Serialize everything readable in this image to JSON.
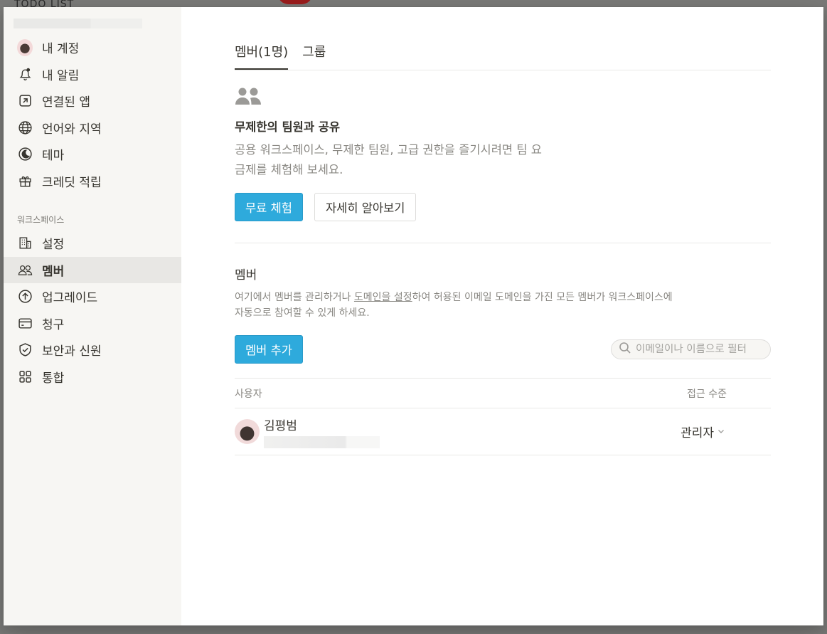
{
  "background": {
    "app_title": "TODO LIST"
  },
  "sidebar": {
    "account_items": [
      {
        "label": "내 계정",
        "icon": "avatar"
      },
      {
        "label": "내 알림",
        "icon": "bell-icon"
      },
      {
        "label": "연결된 앱",
        "icon": "arrow-up-right-box-icon"
      },
      {
        "label": "언어와 지역",
        "icon": "globe-icon"
      },
      {
        "label": "테마",
        "icon": "moon-icon"
      },
      {
        "label": "크레딧 적립",
        "icon": "gift-icon"
      }
    ],
    "workspace_section": "워크스페이스",
    "workspace_items": [
      {
        "label": "설정",
        "icon": "building-icon"
      },
      {
        "label": "멤버",
        "icon": "people-icon",
        "active": true
      },
      {
        "label": "업그레이드",
        "icon": "arrow-up-circle-icon"
      },
      {
        "label": "청구",
        "icon": "credit-card-icon"
      },
      {
        "label": "보안과 신원",
        "icon": "shield-check-icon"
      },
      {
        "label": "통합",
        "icon": "grid-icon"
      }
    ]
  },
  "tabs": [
    {
      "label": "멤버(1명)",
      "active": true
    },
    {
      "label": "그룹",
      "active": false
    }
  ],
  "upsell": {
    "title": "무제한의 팀원과 공유",
    "description": "공용 워크스페이스, 무제한 팀원, 고급 권한을 즐기시려면 팀 요금제를 체험해 보세요.",
    "primary_button": "무료 체험",
    "secondary_button": "자세히 알아보기"
  },
  "members": {
    "heading": "멤버",
    "desc_before": "여기에서 멤버를 관리하거나 ",
    "desc_link": "도메인을 설정",
    "desc_after": "하여 허용된 이메일 도메인을 가진 모든 멤버가 워크스페이스에 자동으로 참여할 수 있게 하세요.",
    "add_button": "멤버 추가",
    "search_placeholder": "이메일이나 이름으로 필터",
    "columns": {
      "user": "사용자",
      "access": "접근 수준"
    },
    "rows": [
      {
        "name": "김평범",
        "role": "관리자"
      }
    ]
  },
  "colors": {
    "accent": "#2eaadc",
    "sidebar_bg": "#f7f6f3",
    "text": "#37352f",
    "muted": "#8a8883"
  }
}
